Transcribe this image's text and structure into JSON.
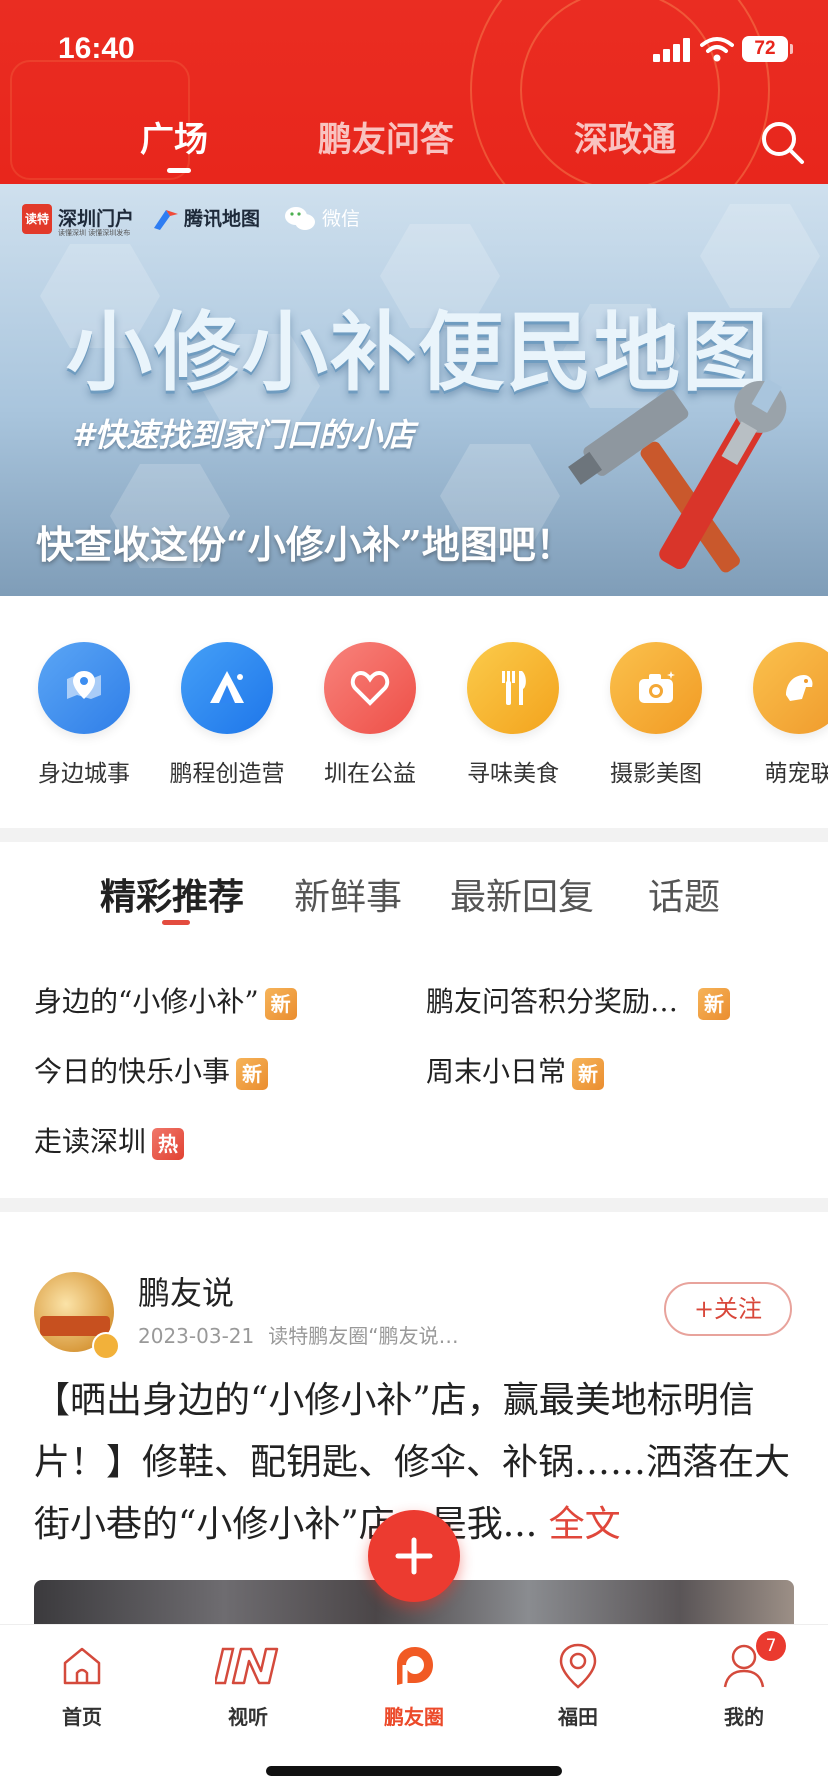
{
  "status_bar": {
    "time": "16:40",
    "battery": "72"
  },
  "top_tabs": [
    {
      "label": "广场",
      "active": true
    },
    {
      "label": "鹏友问答",
      "active": false
    },
    {
      "label": "深政通",
      "active": false
    }
  ],
  "banner": {
    "logos": {
      "dute": "读特",
      "shenzhen_portal": "深圳门户",
      "shenzhen_portal_sub": "读懂深圳 读懂深圳发布",
      "tencent_map": "腾讯地图",
      "wechat": "微信"
    },
    "title": "小修小补便民地图",
    "hashtag": "#快速找到家门口的小店",
    "caption": "快查收这份“小修小补”地图吧！"
  },
  "categories": [
    {
      "label": "身边城事",
      "icon": "map-pin-icon",
      "color": "#3d8ef0"
    },
    {
      "label": "鹏程创造营",
      "icon": "triangle-icon",
      "color": "#2f86f2"
    },
    {
      "label": "圳在公益",
      "icon": "heart-icon",
      "color": "#f0625c"
    },
    {
      "label": "寻味美食",
      "icon": "fork-knife-icon",
      "color": "#f6b62e"
    },
    {
      "label": "摄影美图",
      "icon": "camera-icon",
      "color": "#f4a836"
    },
    {
      "label": "萌宠联",
      "icon": "pet-icon",
      "color": "#f3a33a"
    }
  ],
  "rec_tabs": [
    {
      "label": "精彩推荐",
      "active": true
    },
    {
      "label": "新鲜事",
      "active": false
    },
    {
      "label": "最新回复",
      "active": false
    },
    {
      "label": "话题",
      "active": false
    }
  ],
  "topics": [
    {
      "text": "身边的“小修小补”",
      "badge": "新"
    },
    {
      "text": "鹏友问答积分奖励…",
      "badge": "新"
    },
    {
      "text": "今日的快乐小事",
      "badge": "新"
    },
    {
      "text": "周末小日常",
      "badge": "新"
    },
    {
      "text": "走读深圳",
      "badge": "热"
    }
  ],
  "post": {
    "author": "鹏友说",
    "date": "2023-03-21",
    "circle": "读特鹏友圈“鹏友说…",
    "follow_label": "+关注",
    "body": "【晒出身边的“小修小补”店，赢最美地标明信片！】修鞋、配钥匙、修伞、补锅……洒落在大街小巷的“小修小补”店，是我...",
    "more_label": "全文"
  },
  "bottom_nav": [
    {
      "label": "首页",
      "icon": "home-icon",
      "active": false
    },
    {
      "label": "视听",
      "icon": "in-logo-icon",
      "active": false
    },
    {
      "label": "鹏友圈",
      "icon": "pengyou-circle-icon",
      "active": true
    },
    {
      "label": "福田",
      "icon": "location-pin-icon",
      "active": false
    },
    {
      "label": "我的",
      "icon": "user-icon",
      "active": false,
      "badge": "7"
    }
  ],
  "colors": {
    "brand_red": "#e8261c",
    "accent": "#e34c3f",
    "new_badge": "#ea8d2f",
    "hot_badge": "#e14232"
  }
}
